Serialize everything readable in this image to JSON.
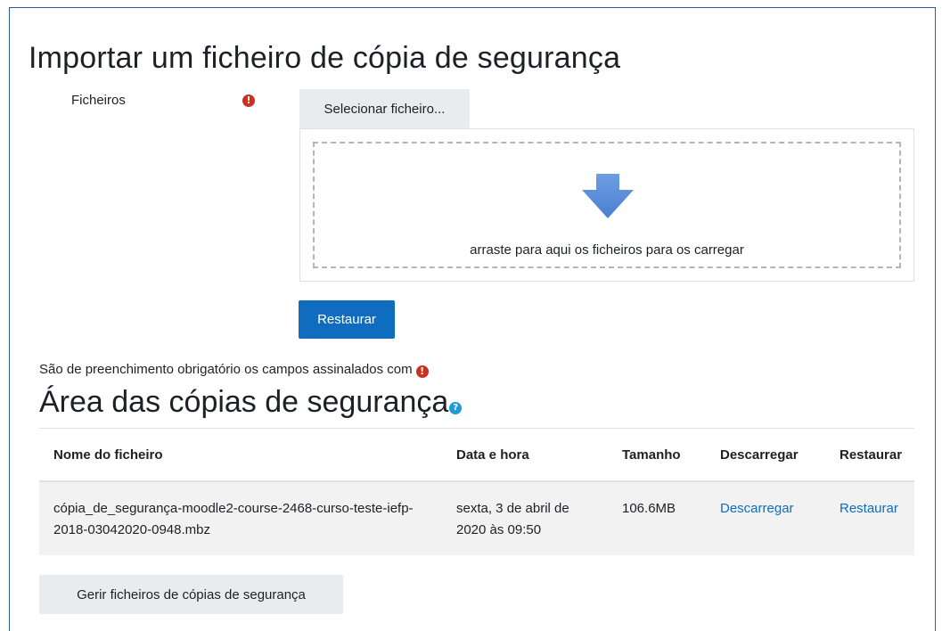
{
  "import_section": {
    "title": "Importar um ficheiro de cópia de segurança",
    "files_label": "Ficheiros",
    "required_icon_glyph": "!",
    "select_file_label": "Selecionar ficheiro...",
    "dropzone_text": "arraste para aqui os ficheiros para os carregar",
    "restore_button_label": "Restaurar",
    "required_note": "São de preenchimento obrigatório os campos assinalados com"
  },
  "backup_area": {
    "title": "Área das cópias de segurança",
    "help_icon_glyph": "?",
    "table": {
      "columns": [
        "Nome do ficheiro",
        "Data e hora",
        "Tamanho",
        "Descarregar",
        "Restaurar"
      ],
      "rows": [
        {
          "filename": "cópia_de_segurança-moodle2-course-2468-curso-teste-iefp-2018-03042020-0948.mbz",
          "datetime": "sexta, 3 de abril de 2020 às 09:50",
          "size": "106.6MB",
          "download": "Descarregar",
          "restore": "Restaurar"
        }
      ]
    },
    "manage_button_label": "Gerir ficheiros de cópias de segurança"
  },
  "colors": {
    "primary": "#0f6cbf",
    "required": "#ca3120",
    "help": "#1f9bd6",
    "secondary_button": "#e9ecef",
    "drop_arrow": "#5b8ed9"
  },
  "icons": {
    "required": "exclamation-circle-icon",
    "help": "question-circle-icon",
    "drop": "arrow-down-icon"
  }
}
